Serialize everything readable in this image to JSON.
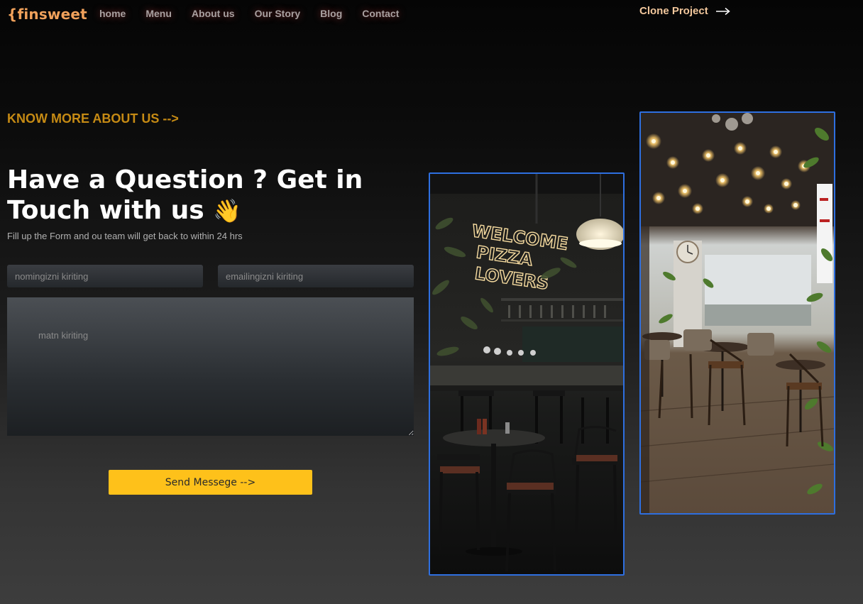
{
  "brand": {
    "logo": "{finsweet"
  },
  "nav": {
    "items": [
      {
        "label": "home"
      },
      {
        "label": "Menu"
      },
      {
        "label": "About us"
      },
      {
        "label": "Our Story"
      },
      {
        "label": "Blog"
      },
      {
        "label": "Contact"
      }
    ],
    "clone_label": "Clone Project",
    "clone_icon": "arrow-right-icon"
  },
  "hero": {
    "know_more": "KNOW MORE ABOUT US -->",
    "title": "Have a Question ? Get in Touch with us",
    "wave_emoji": "👋",
    "subtitle": "Fill up the Form and ou team will get back to within 24 hrs"
  },
  "form": {
    "name_placeholder": "nomingizni kiriting",
    "email_placeholder": "emailingizni kiriting",
    "message_placeholder": "matn kiriting",
    "send_label": "Send Messege -->"
  },
  "gallery": {
    "left_neon": [
      "WELCOME",
      "PIZZA",
      "LOVERS"
    ],
    "accent_color": "#2e6fe0"
  }
}
